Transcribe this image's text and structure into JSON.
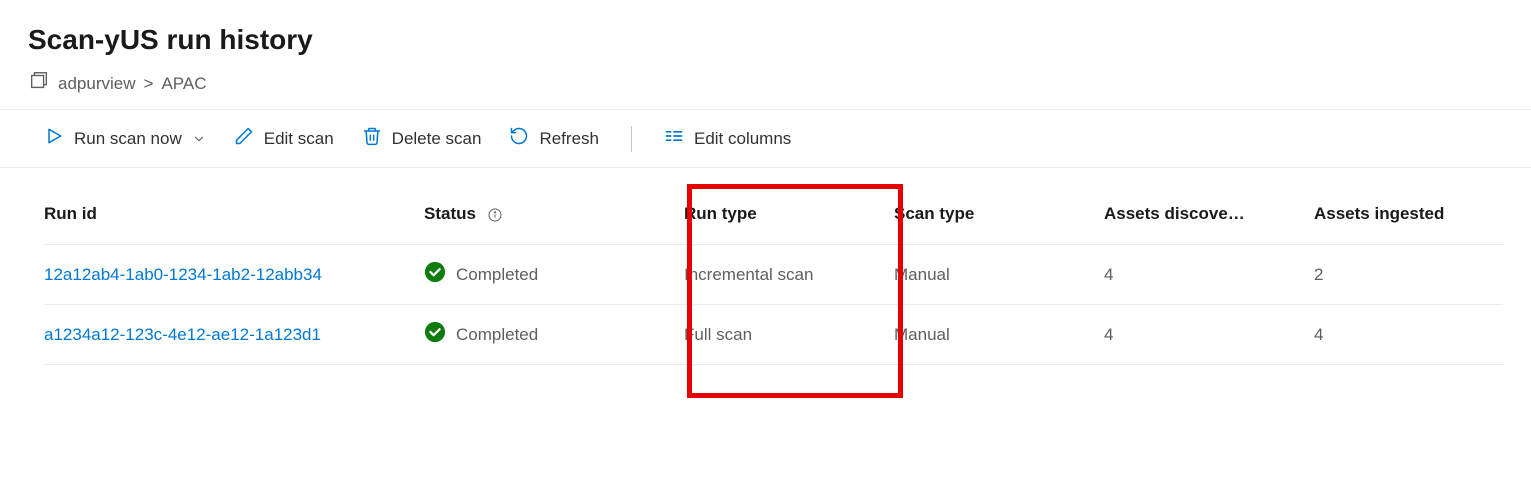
{
  "header": {
    "title": "Scan-yUS run history",
    "breadcrumb": {
      "root": "adpurview",
      "leaf": "APAC",
      "sep": ">"
    }
  },
  "toolbar": {
    "run_scan": "Run scan now",
    "edit_scan": "Edit scan",
    "delete_scan": "Delete scan",
    "refresh": "Refresh",
    "edit_columns": "Edit columns"
  },
  "table": {
    "columns": {
      "run_id": "Run id",
      "status": "Status",
      "run_type": "Run type",
      "scan_type": "Scan type",
      "discovered": "Assets discove…",
      "ingested": "Assets ingested"
    },
    "rows": [
      {
        "run_id": "12a12ab4-1ab0-1234-1ab2-12abb34",
        "status": "Completed",
        "run_type": "Incremental scan",
        "scan_type": "Manual",
        "discovered": "4",
        "ingested": "2"
      },
      {
        "run_id": "a1234a12-123c-4e12-ae12-1a123d1",
        "status": "Completed",
        "run_type": "Full scan",
        "scan_type": "Manual",
        "discovered": "4",
        "ingested": "4"
      }
    ]
  }
}
